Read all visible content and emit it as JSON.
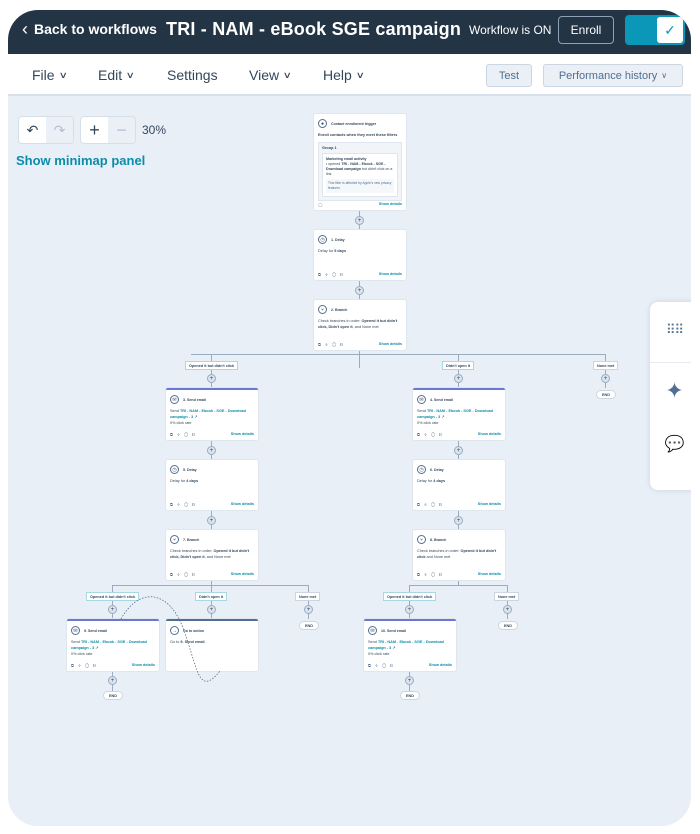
{
  "header": {
    "back_label": "Back to workflows",
    "title": "TRI - NAM - eBook SGE campaign",
    "status": "Workflow is ON",
    "enroll_label": "Enroll",
    "toggle_on": true,
    "accent_color": "#0b97b8"
  },
  "menubar": {
    "items": [
      {
        "label": "File",
        "has_caret": true
      },
      {
        "label": "Edit",
        "has_caret": true
      },
      {
        "label": "Settings",
        "has_caret": false
      },
      {
        "label": "View",
        "has_caret": true
      },
      {
        "label": "Help",
        "has_caret": true
      }
    ],
    "test_label": "Test",
    "performance_label": "Performance history"
  },
  "canvas": {
    "zoom_level": "30%",
    "minimap_label": "Show minimap panel",
    "caret": "⌄",
    "show_details": "Show details",
    "footer_icons": "⧉ ✣ ◯ ▯",
    "plus": "+",
    "end_label": "END"
  },
  "trigger": {
    "label": "Contact enrollment trigger",
    "body": "Enroll contacts when they meet these filters",
    "group_title": "Group 1",
    "filter_title": "Marketing email activity",
    "filter_prefix": "• opened ",
    "filter_link": "TRI - NAM - Ebook - SGE - Download campaign",
    "filter_suffix": " but didn't click on a link",
    "note": "This filter is affected by Apple's new privacy features"
  },
  "actions": {
    "a1": {
      "label": "1. Delay",
      "pre": "Delay for ",
      "bold": "5 days",
      "post": ""
    },
    "a2": {
      "label": "2. Branch",
      "pre": "Check branches in order: ",
      "bold": "Opened it but didn't click, Didn't open it",
      "post": ", and None met"
    },
    "a3": {
      "label": "3. Send email",
      "pre": "Send ",
      "link": "TRI - NAM - Ebook - SGE - Download campaign - 3",
      "post": "",
      "stat": "0% click rate"
    },
    "a4": {
      "label": "4. Send email",
      "pre": "Send ",
      "link": "TRI - NAM - Ebook - SGE - Download campaign - 3",
      "post": "",
      "stat": "0% click rate"
    },
    "a5": {
      "label": "5. Delay",
      "pre": "Delay for ",
      "bold": "4 days",
      "post": ""
    },
    "a6": {
      "label": "6. Delay",
      "pre": "Delay for ",
      "bold": "4 days",
      "post": ""
    },
    "a7": {
      "label": "7. Branch",
      "pre": "Check branches in order: ",
      "bold": "Opened it but didn't click, Didn't open it",
      "post": ", and None met"
    },
    "a8": {
      "label": "8. Branch",
      "pre": "Check branches in order: ",
      "bold": "Opened it but didn't click",
      "post": " and None met"
    },
    "a9": {
      "label": "9. Send email",
      "pre": "Send ",
      "link": "TRI - NAM - Ebook - SGE - Download campaign - 3",
      "post": "",
      "stat": "0% click rate"
    },
    "goto": {
      "label": "Go to action",
      "pre": "Go to ",
      "bold": "9. Send email",
      "post": "."
    },
    "a10": {
      "label": "10. Send email",
      "pre": "Send ",
      "link": "TRI - NAM - Ebook - SGE - Download campaign - 3",
      "post": "",
      "stat": "0% click rate"
    }
  },
  "branches": {
    "opened_not_clicked": "Opened it but didn't click",
    "didnt_open": "Didn't open it",
    "none_met": "None met"
  },
  "side_panel": {
    "icons": [
      "apps-grid-icon",
      "ai-sparkle-icon",
      "comments-icon"
    ]
  }
}
